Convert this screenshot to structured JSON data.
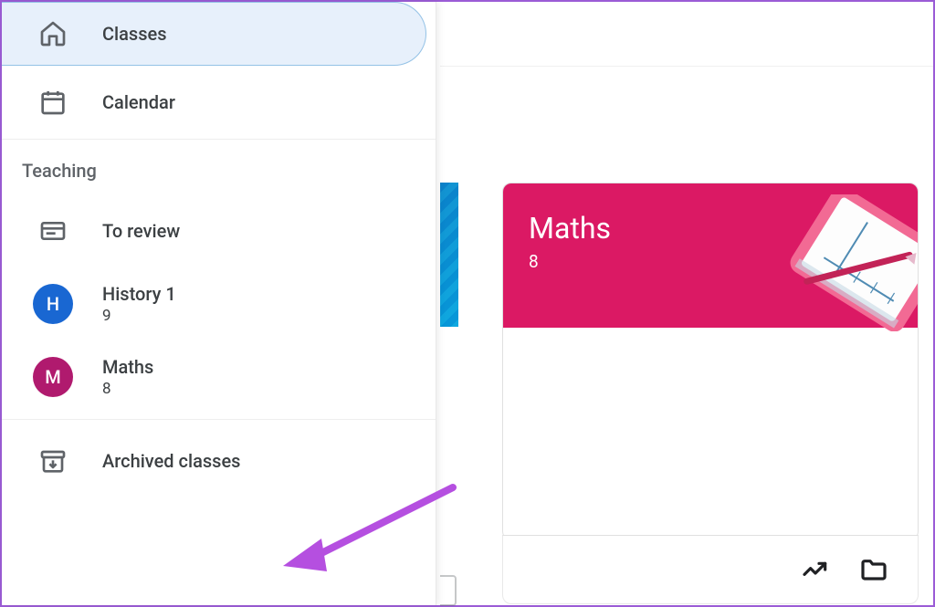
{
  "sidebar": {
    "classes_label": "Classes",
    "calendar_label": "Calendar",
    "teaching_heading": "Teaching",
    "to_review_label": "To review",
    "archived_label": "Archived classes",
    "classes": [
      {
        "initial": "H",
        "name": "History 1",
        "grade": "9"
      },
      {
        "initial": "M",
        "name": "Maths",
        "grade": "8"
      }
    ]
  },
  "main_card": {
    "title": "Maths",
    "grade": "8"
  }
}
